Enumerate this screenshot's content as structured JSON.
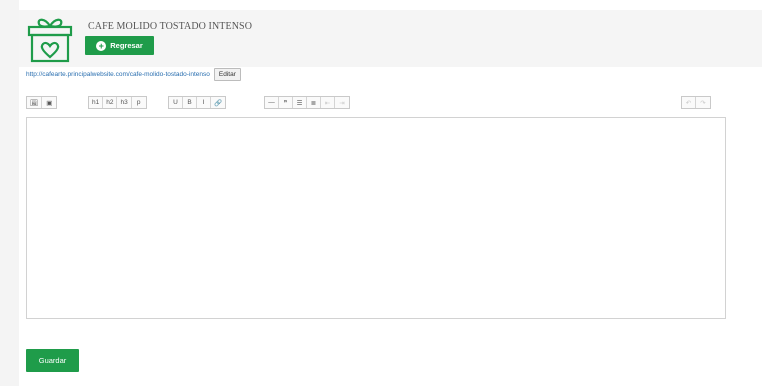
{
  "product": {
    "title": "CAFE MOLIDO TOSTADO INTENSO"
  },
  "header": {
    "back_label": "Regresar",
    "back_icon": "plus-circle-icon",
    "logo_icon": "gift-box-heart-icon"
  },
  "url": {
    "link_text": "http://cafearte.principalwebsite.com/cafe-molido-tostado-intenso",
    "edit_label": "Editar"
  },
  "toolbar": {
    "media": [
      {
        "name": "image-icon",
        "glyph": "🖼"
      },
      {
        "name": "video-icon",
        "glyph": "▣"
      }
    ],
    "headings": [
      "h1",
      "h2",
      "h3",
      "p"
    ],
    "format": [
      {
        "name": "underline-icon",
        "glyph": "U"
      },
      {
        "name": "bold-icon",
        "glyph": "B"
      },
      {
        "name": "italic-icon",
        "glyph": "I"
      },
      {
        "name": "link-icon",
        "glyph": "🔗"
      }
    ],
    "blocks": [
      {
        "name": "horizontal-rule-icon",
        "glyph": "—"
      },
      {
        "name": "quote-icon",
        "glyph": "❞"
      },
      {
        "name": "unordered-list-icon",
        "glyph": "☰"
      },
      {
        "name": "ordered-list-icon",
        "glyph": "≣"
      },
      {
        "name": "outdent-icon",
        "glyph": "⇤"
      },
      {
        "name": "indent-icon",
        "glyph": "⇥"
      }
    ],
    "history": [
      {
        "name": "undo-icon",
        "glyph": "↶"
      },
      {
        "name": "redo-icon",
        "glyph": "↷"
      }
    ]
  },
  "editor": {
    "content": ""
  },
  "footer": {
    "save_label": "Guardar"
  },
  "colors": {
    "accent": "#1f9c4a",
    "link": "#2a6fb0",
    "header_bg": "#f5f5f5"
  }
}
